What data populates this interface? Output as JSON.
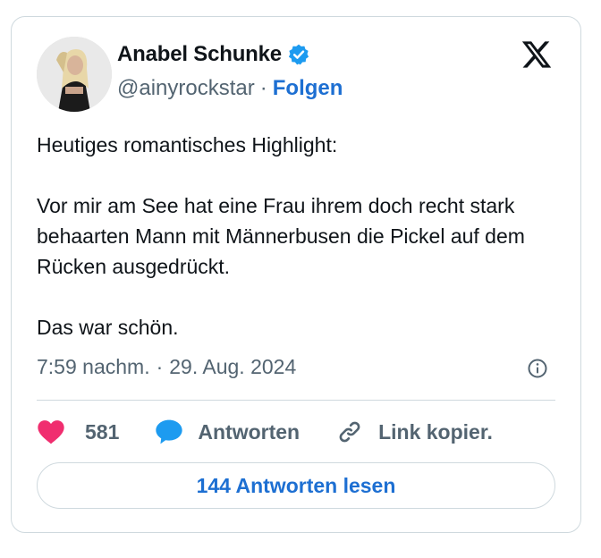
{
  "colors": {
    "text": "#0f1419",
    "secondary": "#536471",
    "link": "#1d6fd2",
    "border": "#cfd9de",
    "heart": "#f02e6f",
    "reply_bubble": "#1d9bf0",
    "verified": "#1d9bf0"
  },
  "author": {
    "name": "Anabel Schunke",
    "handle": "@ainyrockstar",
    "separator": "·",
    "follow_label": "Folgen",
    "verified_icon": "verified-badge-icon",
    "avatar": "avatar-photo"
  },
  "platform_icon": "x-logo-icon",
  "tweet": {
    "text": "Heutiges romantisches Highlight:\n\nVor mir am See hat eine Frau ihrem doch recht stark behaarten Mann mit Männerbusen die Pickel auf dem Rücken ausgedrückt.\n\nDas war schön.",
    "time": "7:59 nachm.",
    "separator": "·",
    "date": "29. Aug. 2024"
  },
  "actions": {
    "likes_count": "581",
    "reply_label": "Antworten",
    "copy_link_label": "Link kopier."
  },
  "read_replies_label": "144 Antworten lesen"
}
